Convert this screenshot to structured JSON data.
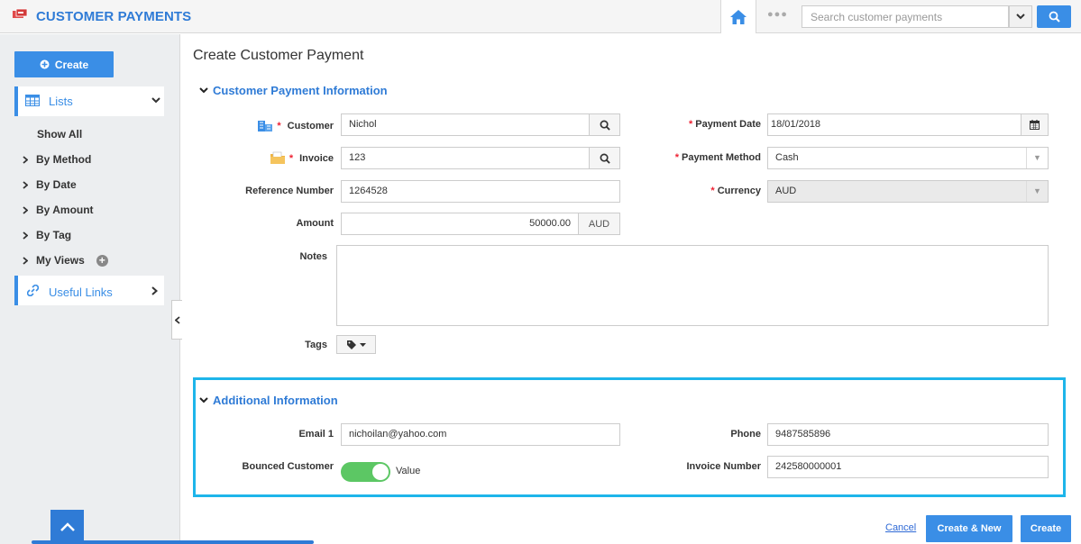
{
  "header": {
    "app_title": "CUSTOMER PAYMENTS",
    "dots": "●●●",
    "search_placeholder": "Search customer payments"
  },
  "sidebar": {
    "create_label": "Create",
    "lists_label": "Lists",
    "items": [
      {
        "label": "Show All"
      },
      {
        "label": "By Method"
      },
      {
        "label": "By Date"
      },
      {
        "label": "By Amount"
      },
      {
        "label": "By Tag"
      },
      {
        "label": "My Views"
      }
    ],
    "useful_links_label": "Useful Links"
  },
  "main": {
    "page_title": "Create Customer Payment",
    "payment_section": {
      "title": "Customer Payment Information",
      "customer_label": "Customer",
      "customer_value": "Nichol",
      "invoice_label": "Invoice",
      "invoice_value": "123",
      "reference_label": "Reference Number",
      "reference_value": "1264528",
      "amount_label": "Amount",
      "amount_value": "50000.00",
      "amount_currency": "AUD",
      "notes_label": "Notes",
      "tags_label": "Tags",
      "payment_date_label": "Payment Date",
      "payment_date_value": "18/01/2018",
      "payment_method_label": "Payment Method",
      "payment_method_value": "Cash",
      "currency_label": "Currency",
      "currency_value": "AUD"
    },
    "additional_section": {
      "title": "Additional Information",
      "email_label": "Email 1",
      "email_value": "nichoilan@yahoo.com",
      "bounced_label": "Bounced Customer",
      "bounced_toggle_label": "Value",
      "bounced_on": true,
      "phone_label": "Phone",
      "phone_value": "9487585896",
      "invoice_number_label": "Invoice Number",
      "invoice_number_value": "242580000001"
    },
    "footer": {
      "cancel_label": "Cancel",
      "create_new_label": "Create & New",
      "create_label": "Create"
    }
  },
  "colors": {
    "accent": "#3a8ee6",
    "highlight_border": "#1eb5ea",
    "toggle_on": "#5cc764",
    "required": "#e23333"
  }
}
